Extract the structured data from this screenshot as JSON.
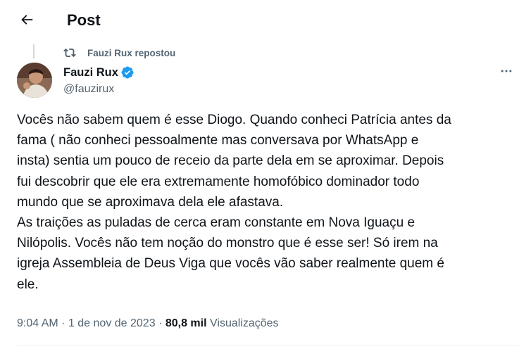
{
  "header": {
    "title": "Post"
  },
  "repost": {
    "text": "Fauzi Rux repostou"
  },
  "author": {
    "name": "Fauzi Rux",
    "handle": "@fauzirux",
    "verified": true,
    "verified_color": "#1d9bf0"
  },
  "tweet": {
    "lines": [
      "Vocês não sabem quem é esse Diogo. Quando conheci Patrícia antes da",
      "fama ( não conheci pessoalmente mas conversava por WhatsApp e",
      "insta) sentia um pouco de receio da parte dela em se aproximar. Depois",
      "fui descobrir que ele era extremamente homofóbico dominador todo",
      "mundo que se aproximava dela ele afastava.",
      "As traições as puladas de cerca eram constante em Nova Iguaçu e",
      "Nilópolis. Vocês não tem noção do monstro que é esse ser! Só irem na",
      "igreja Assembleia de Deus Viga que vocês vão saber realmente quem é",
      "ele."
    ]
  },
  "meta": {
    "time": "9:04 AM",
    "separator": "·",
    "date": "1 de nov de 2023",
    "views_count": "80,8 mil",
    "views_label": "Visualizações"
  },
  "icons": {
    "back": "arrow-left-icon",
    "repost": "repost-icon",
    "verified": "verified-badge-icon",
    "more": "more-icon"
  },
  "colors": {
    "text_primary": "#0f1419",
    "text_secondary": "#536471",
    "accent": "#1d9bf0"
  }
}
